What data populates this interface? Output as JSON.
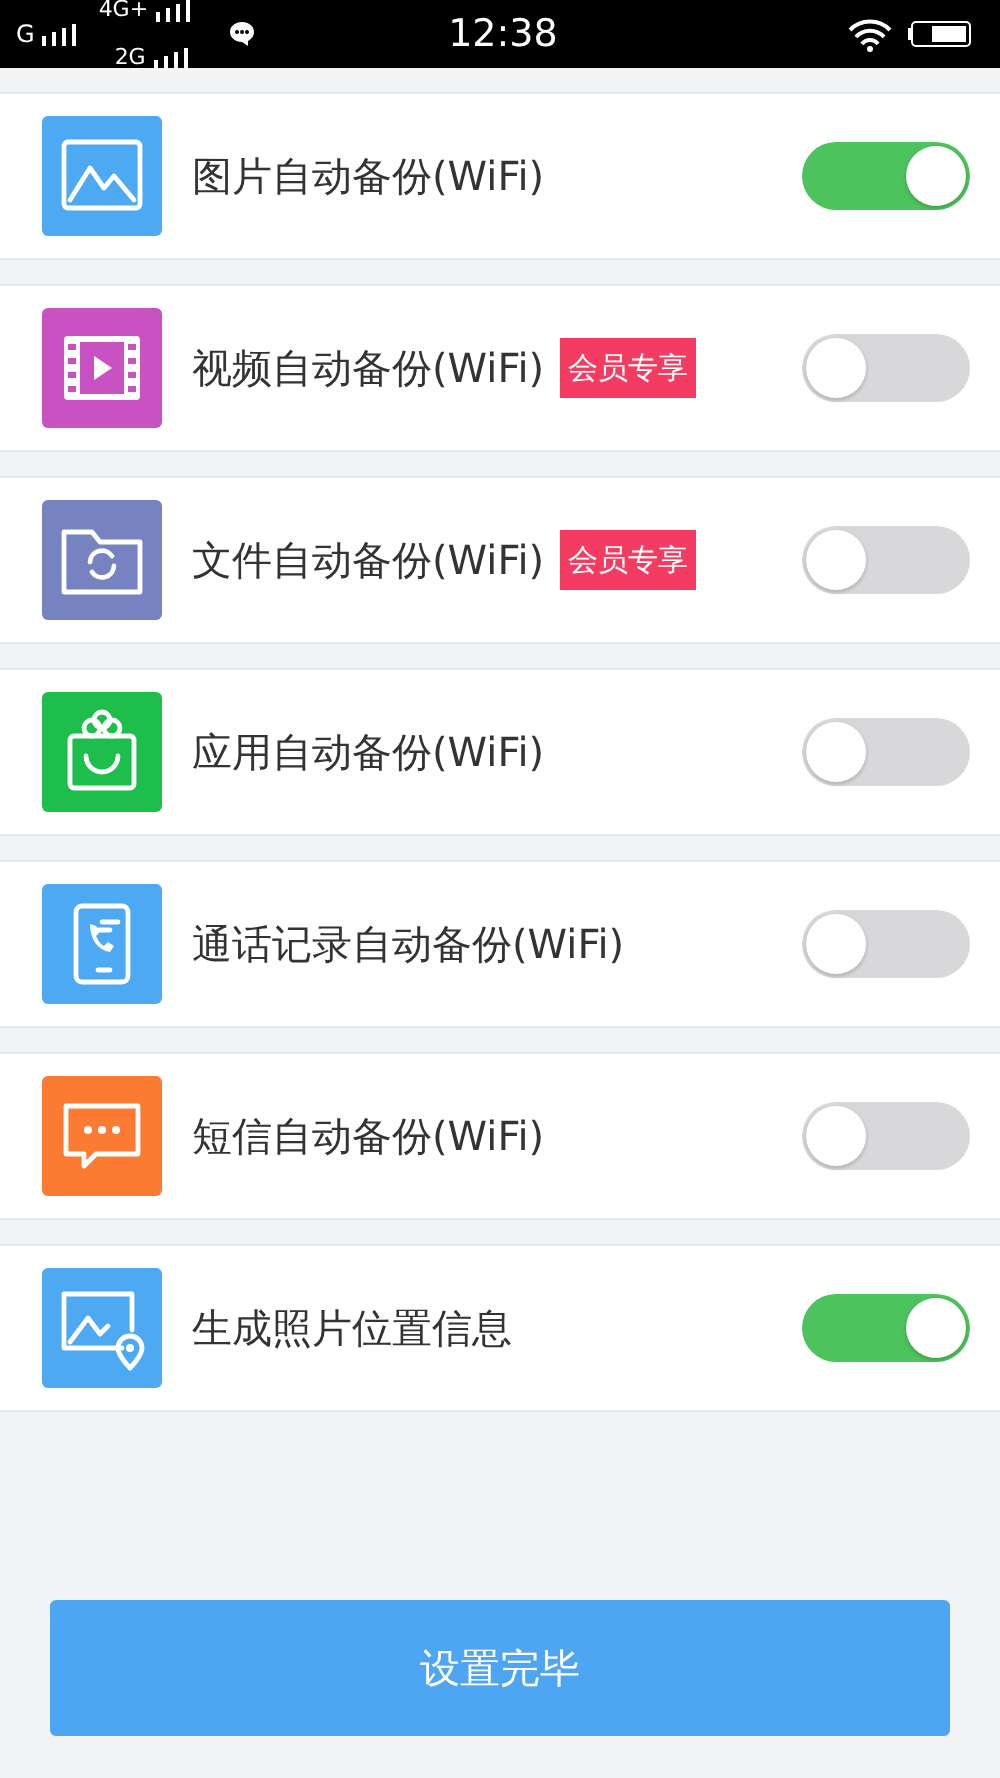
{
  "status_bar": {
    "carrier_1": "G",
    "carrier_2_top": "4G+",
    "carrier_2_bottom": "2G",
    "time": "12:38"
  },
  "items": [
    {
      "kind": "picture",
      "color": "#4ea9f3",
      "label": "图片自动备份(WiFi)",
      "on": true
    },
    {
      "kind": "video",
      "color": "#c952c2",
      "label": "视频自动备份(WiFi)",
      "badge": "会员专享",
      "on": false
    },
    {
      "kind": "folder",
      "color": "#7683c0",
      "label": "文件自动备份(WiFi)",
      "badge": "会员专享",
      "on": false
    },
    {
      "kind": "bag",
      "color": "#1dbe4c",
      "label": "应用自动备份(WiFi)",
      "on": false
    },
    {
      "kind": "call",
      "color": "#4ea9f3",
      "label": "通话记录自动备份(WiFi)",
      "on": false
    },
    {
      "kind": "message",
      "color": "#fa7b31",
      "label": "短信自动备份(WiFi)",
      "on": false
    },
    {
      "kind": "location",
      "color": "#4ea9f3",
      "label": "生成照片位置信息",
      "on": true
    }
  ],
  "done_button": "设置完毕"
}
